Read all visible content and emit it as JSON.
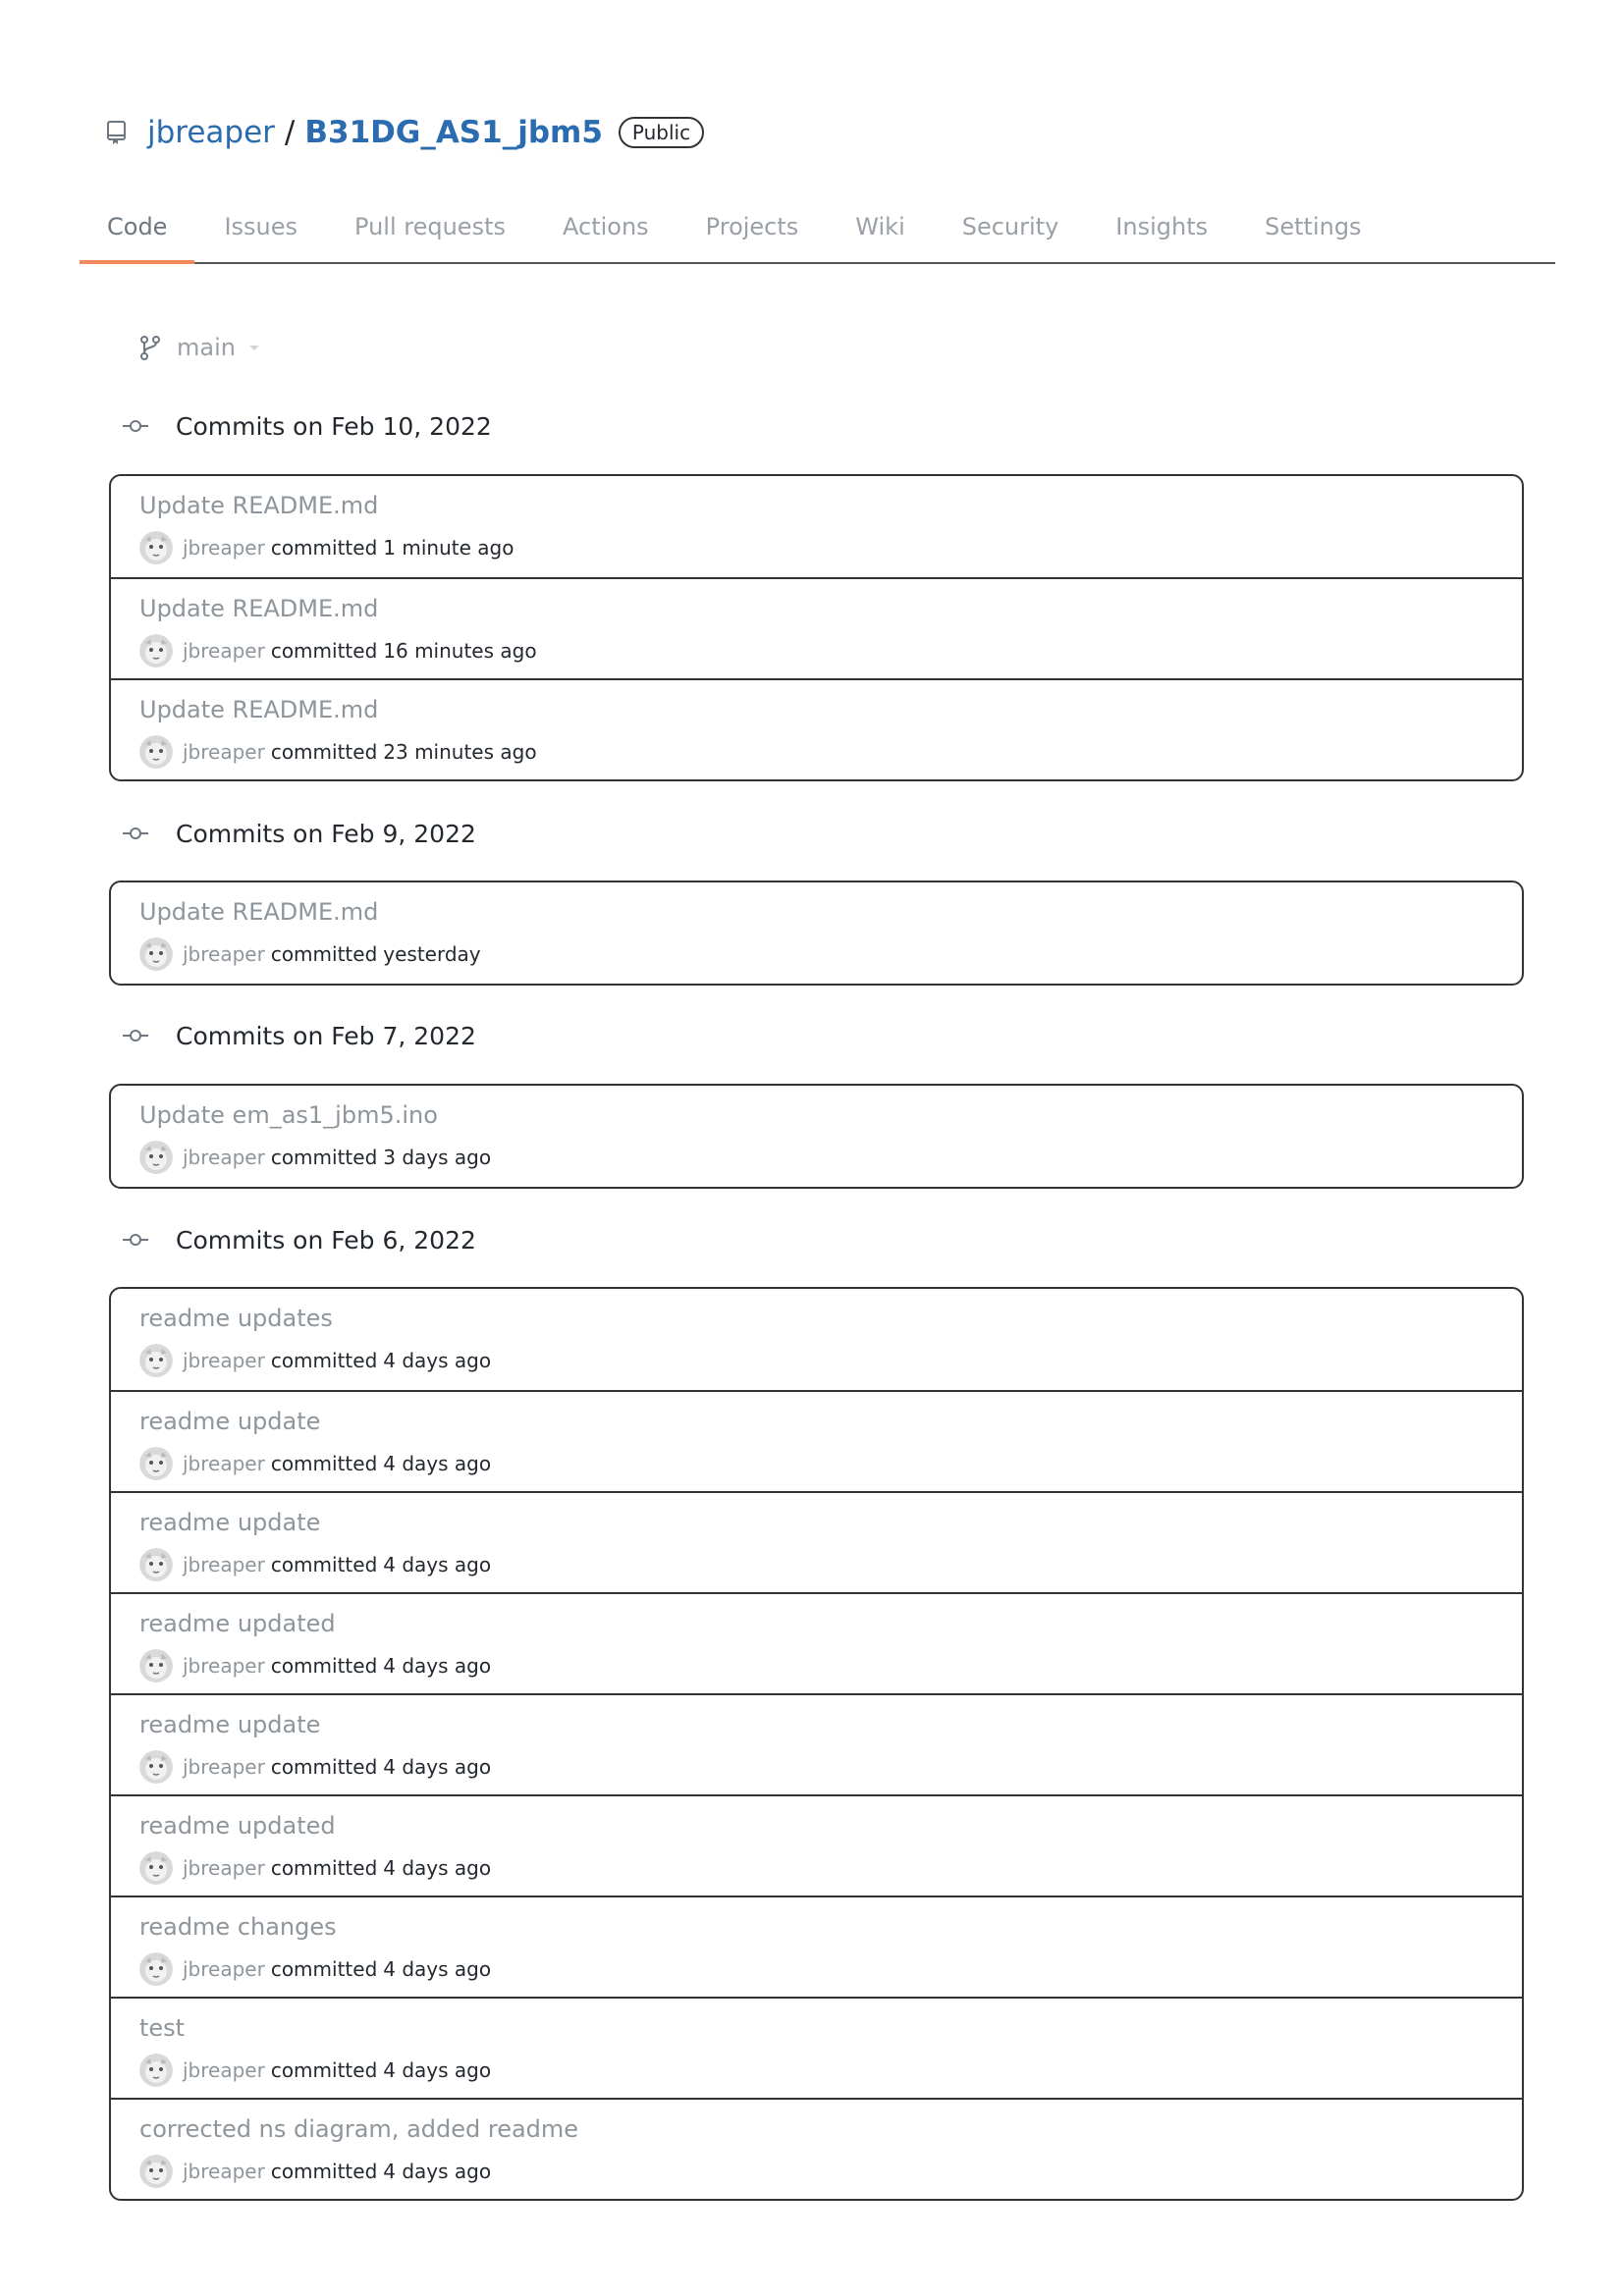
{
  "repo": {
    "owner": "jbreaper",
    "separator": "/",
    "name": "B31DG_AS1_jbm5",
    "visibility": "Public"
  },
  "tabs": [
    "Code",
    "Issues",
    "Pull requests",
    "Actions",
    "Projects",
    "Wiki",
    "Security",
    "Insights",
    "Settings"
  ],
  "active_tab": "Code",
  "branch": "main",
  "groups": [
    {
      "label": "Commits on Feb 10, 2022",
      "commits": [
        {
          "message": "Update README.md",
          "author": "jbreaper",
          "verb": "committed",
          "time": "1 minute ago"
        },
        {
          "message": "Update README.md",
          "author": "jbreaper",
          "verb": "committed",
          "time": "16 minutes ago"
        },
        {
          "message": "Update README.md",
          "author": "jbreaper",
          "verb": "committed",
          "time": "23 minutes ago"
        }
      ]
    },
    {
      "label": "Commits on Feb 9, 2022",
      "commits": [
        {
          "message": "Update README.md",
          "author": "jbreaper",
          "verb": "committed",
          "time": "yesterday"
        }
      ]
    },
    {
      "label": "Commits on Feb 7, 2022",
      "commits": [
        {
          "message": "Update em_as1_jbm5.ino",
          "author": "jbreaper",
          "verb": "committed",
          "time": "3 days ago"
        }
      ]
    },
    {
      "label": "Commits on Feb 6, 2022",
      "commits": [
        {
          "message": "readme updates",
          "author": "jbreaper",
          "verb": "committed",
          "time": "4 days ago"
        },
        {
          "message": "readme update",
          "author": "jbreaper",
          "verb": "committed",
          "time": "4 days ago"
        },
        {
          "message": "readme update",
          "author": "jbreaper",
          "verb": "committed",
          "time": "4 days ago"
        },
        {
          "message": "readme updated",
          "author": "jbreaper",
          "verb": "committed",
          "time": "4 days ago"
        },
        {
          "message": "readme update",
          "author": "jbreaper",
          "verb": "committed",
          "time": "4 days ago"
        },
        {
          "message": "readme updated",
          "author": "jbreaper",
          "verb": "committed",
          "time": "4 days ago"
        },
        {
          "message": "readme changes",
          "author": "jbreaper",
          "verb": "committed",
          "time": "4 days ago"
        },
        {
          "message": "test",
          "author": "jbreaper",
          "verb": "committed",
          "time": "4 days ago"
        },
        {
          "message": "corrected ns diagram, added readme",
          "author": "jbreaper",
          "verb": "committed",
          "time": "4 days ago"
        }
      ]
    }
  ],
  "icons": {
    "repo": "repo-icon",
    "branch": "git-branch-icon",
    "commit": "git-commit-icon",
    "avatar": "user-avatar"
  },
  "colors": {
    "link": "#2b6cb0",
    "active_tab_underline": "#f08a5d",
    "muted": "#8e959b"
  }
}
